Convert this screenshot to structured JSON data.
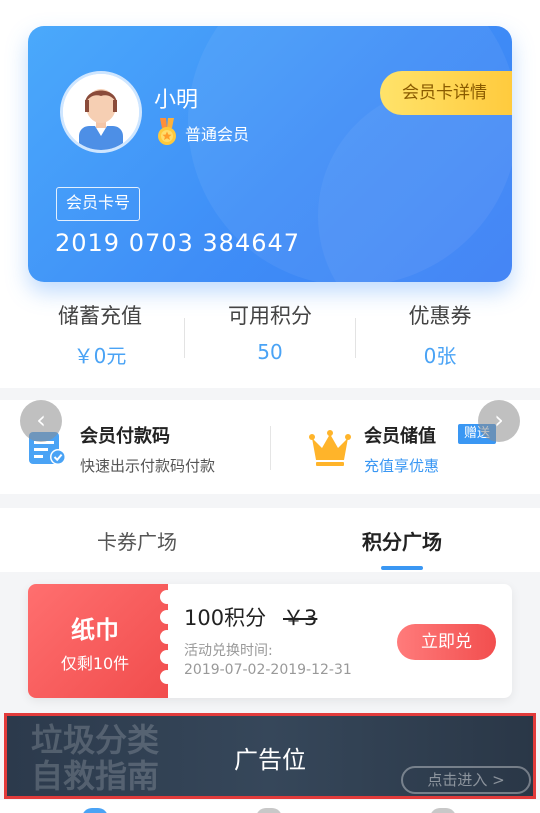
{
  "member": {
    "name": "小明",
    "level": "普通会员",
    "detail_button": "会员卡详情",
    "card_number_label": "会员卡号",
    "card_number": "2019 0703 384647"
  },
  "stats": [
    {
      "label": "储蓄充值",
      "value": "￥0元"
    },
    {
      "label": "可用积分",
      "value": "50"
    },
    {
      "label": "优惠券",
      "value": "0张"
    }
  ],
  "quick_actions": {
    "pay_code": {
      "title": "会员付款码",
      "subtitle": "快速出示付款码付款",
      "icon": "qr-card-icon"
    },
    "stored_value": {
      "title": "会员储值",
      "badge": "赠送",
      "subtitle": "充值享优惠",
      "icon": "crown-icon"
    }
  },
  "tabs": [
    {
      "label": "卡券广场",
      "active": false
    },
    {
      "label": "积分广场",
      "active": true
    }
  ],
  "coupon": {
    "type": "纸巾",
    "stock": "仅剩10件",
    "points": "100积分",
    "original_price": "￥3",
    "time_label": "活动兑换时间:",
    "time_range": "2019-07-02-2019-12-31",
    "redeem_button": "立即兑"
  },
  "ad": {
    "label": "广告位",
    "banner_text_line1": "垃圾分类",
    "banner_text_line2": "自救指南",
    "enter_button": "点击进入 >"
  },
  "colors": {
    "card_blue": "#3f8ef7",
    "accent_blue": "#3a97f3",
    "gold": "#ffc93b",
    "coupon_red": "#f14d4d",
    "ad_border": "#e23b3b"
  }
}
